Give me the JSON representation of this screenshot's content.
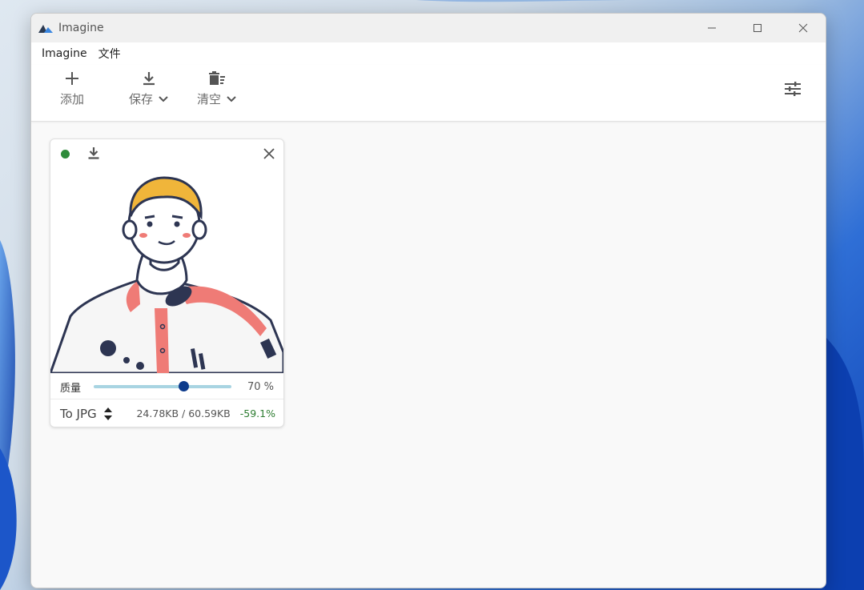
{
  "window": {
    "title": "Imagine"
  },
  "menu": {
    "items": [
      "Imagine",
      "文件"
    ]
  },
  "toolbar": {
    "add_label": "添加",
    "save_label": "保存",
    "clear_label": "清空"
  },
  "card": {
    "status_color": "#2e8b3a",
    "quality_label": "质量",
    "quality_value": "70 %",
    "quality_fraction": 0.65,
    "format_label": "To JPG",
    "sizes": "24.78KB / 60.59KB",
    "saving": "-59.1%",
    "saving_color": "#2e7d32"
  },
  "icons": {
    "app": "imagine-logo-icon",
    "add": "plus-icon",
    "save": "download-icon",
    "clear": "trash-icon",
    "dropdown": "chevron-down-icon",
    "settings": "sliders-icon",
    "close": "close-icon",
    "format_toggle": "sort-arrows-icon"
  }
}
